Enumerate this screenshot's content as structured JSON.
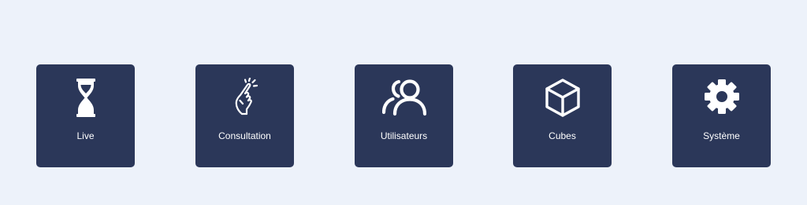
{
  "colors": {
    "background": "#edf2fa",
    "tile": "#2b3759",
    "text": "#ffffff"
  },
  "tiles": [
    {
      "label": "Live",
      "icon": "hourglass-icon"
    },
    {
      "label": "Consultation",
      "icon": "pointing-hand-icon"
    },
    {
      "label": "Utilisateurs",
      "icon": "users-icon"
    },
    {
      "label": "Cubes",
      "icon": "cube-icon"
    },
    {
      "label": "Système",
      "icon": "gear-icon"
    }
  ]
}
